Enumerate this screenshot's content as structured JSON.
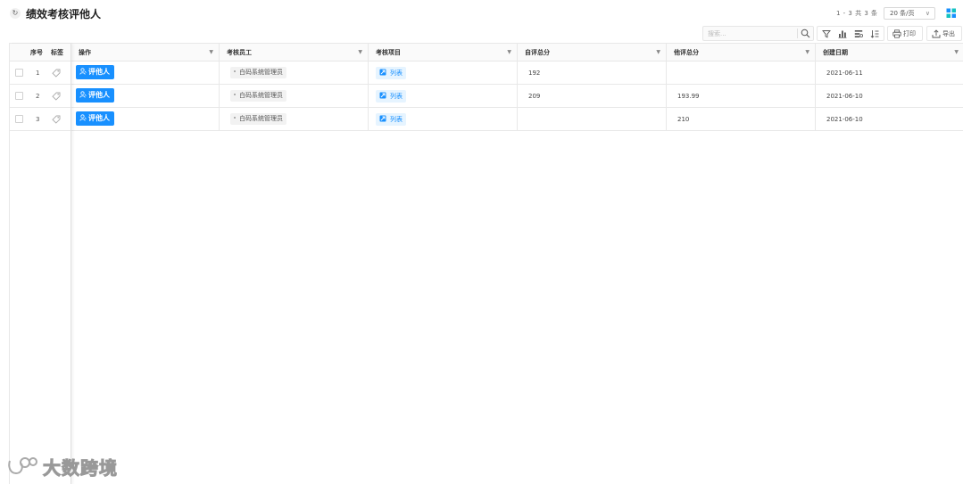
{
  "page": {
    "title": "绩效考核评他人",
    "pager_text": "1 - 3  共  3  条",
    "page_size": "20 条/页"
  },
  "toolbar": {
    "search_placeholder": "搜索...",
    "print_label": "打印",
    "export_label": "导出"
  },
  "table": {
    "fixed_headers": {
      "seq": "序号",
      "tag": "标签"
    },
    "headers": {
      "action": "操作",
      "employee": "考核员工",
      "project": "考核项目",
      "self_total": "自评总分",
      "other_total": "他评总分",
      "created": "创建日期"
    },
    "rows": [
      {
        "seq": "1",
        "action": "评他人",
        "employee": "白码系统管理员",
        "project": "列表",
        "self_total": "192",
        "other_total": "",
        "created": "2021-06-11"
      },
      {
        "seq": "2",
        "action": "评他人",
        "employee": "白码系统管理员",
        "project": "列表",
        "self_total": "209",
        "other_total": "193.99",
        "created": "2021-06-10"
      },
      {
        "seq": "3",
        "action": "评他人",
        "employee": "白码系统管理员",
        "project": "列表",
        "self_total": "",
        "other_total": "210",
        "created": "2021-06-10"
      }
    ]
  },
  "watermark": {
    "text": "大数跨境"
  },
  "colors": {
    "primary": "#1890ff",
    "accent_teal": "#13c2c2",
    "border": "#e8e8e8"
  },
  "icons": {
    "refresh": "refresh-icon",
    "layout": "layout-grid-icon",
    "search": "search-icon",
    "filter": "filter-icon",
    "chart": "bar-chart-icon",
    "group": "group-icon",
    "sort": "sort-icon",
    "print": "print-icon",
    "export": "export-icon",
    "tag": "tag-icon",
    "user": "user-icon",
    "list": "list-icon"
  }
}
